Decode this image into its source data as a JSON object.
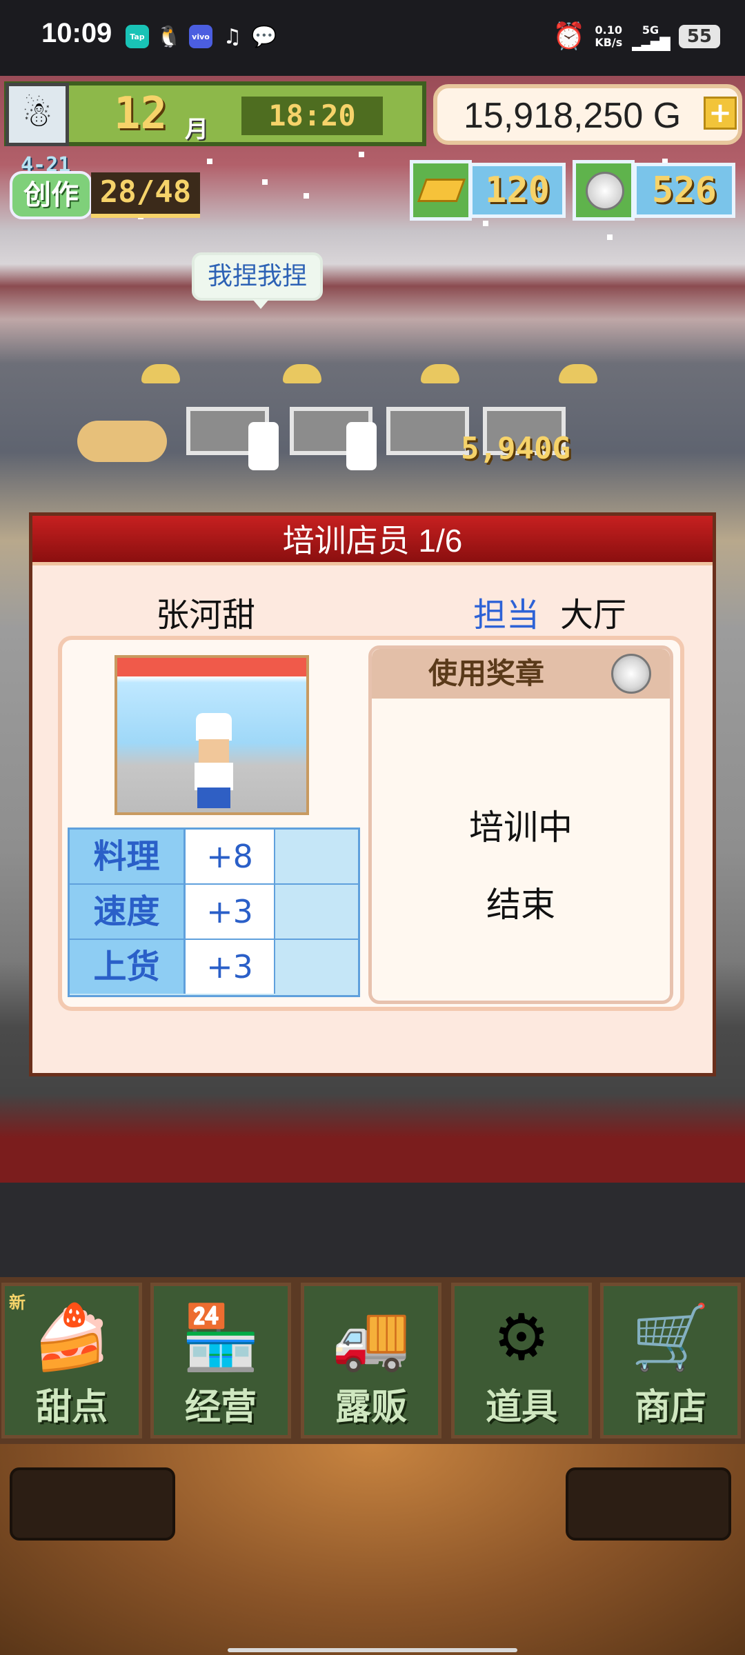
{
  "status_bar": {
    "time": "10:09",
    "apps": [
      "Tap",
      "QQ",
      "vivo",
      "TikTok",
      "WeChat"
    ],
    "net_speed": "0.10",
    "net_unit": "KB/s",
    "network": "5G",
    "battery": "55"
  },
  "hud": {
    "month": "12",
    "month_unit": "月",
    "clock": "18:20",
    "money": "15,918,250 G",
    "create_level": "4-21",
    "create_label": "创作",
    "create_count": "28/48",
    "gold_bars": "120",
    "medals": "526"
  },
  "scene": {
    "speech": "我捏我捏",
    "earnings": "5,940G"
  },
  "dialog": {
    "title": "培训店员 1/6",
    "staff_name": "张河甜",
    "assign_label": "担当",
    "assign_value": "大厅",
    "stats": [
      {
        "name": "料理",
        "value": "+8"
      },
      {
        "name": "速度",
        "value": "+3"
      },
      {
        "name": "上货",
        "value": "+3"
      }
    ],
    "medal_header": "使用奖章",
    "training_text": "培训中",
    "finish_text": "结束"
  },
  "nav": {
    "new_tag": "新",
    "items": [
      {
        "label": "甜点",
        "icon": "cake-icon"
      },
      {
        "label": "经营",
        "icon": "shop-building-icon"
      },
      {
        "label": "露贩",
        "icon": "food-truck-icon"
      },
      {
        "label": "道具",
        "icon": "gear-bag-icon"
      },
      {
        "label": "商店",
        "icon": "shopping-cart-icon"
      }
    ]
  },
  "colors": {
    "title_red": "#c72020",
    "stat_blue": "#2a5fc8",
    "nav_green": "#3d5a34",
    "gold": "#f6d36a"
  }
}
